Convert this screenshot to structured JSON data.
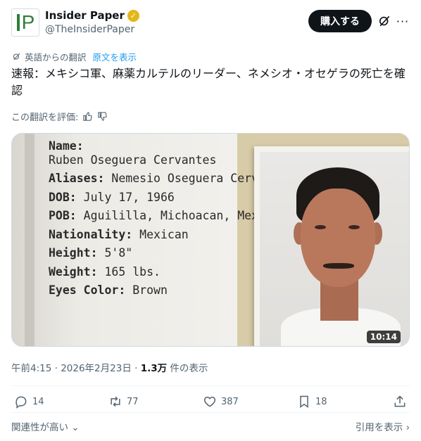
{
  "author": {
    "avatar_text": "P",
    "name": "Insider Paper",
    "handle": "@TheInsiderPaper"
  },
  "header": {
    "subscribe_label": "購入する",
    "more_label": "···"
  },
  "translation": {
    "note": "英語からの翻訳",
    "show_original": "原文を表示",
    "rate_label": "この翻訳を評価:"
  },
  "tweet": {
    "text": "速報：メキシコ軍、麻薬カルテルのリーダー、ネメシオ・オセゲラの死亡を確認"
  },
  "media": {
    "dossier": [
      {
        "label": "Name:",
        "value": "Ruben Oseguera Cervantes",
        "label_bold": true,
        "break": true
      },
      {
        "label": "Aliases:",
        "value": " Nemesio Oseguera Cervantes, \"el Mencho\"",
        "label_bold": true,
        "break": false
      },
      {
        "label": "DOB:",
        "value": " July 17, 1966",
        "label_bold": true,
        "break": false
      },
      {
        "label": "POB:",
        "value": " Aguililla, Michoacan, Mexico",
        "label_bold": true,
        "break": false
      },
      {
        "label": "Nationality:",
        "value": " Mexican",
        "label_bold": true,
        "break": false
      },
      {
        "label": "Height:",
        "value": " 5'8\"",
        "label_bold": true,
        "break": false
      },
      {
        "label": "Weight:",
        "value": " 165 lbs.",
        "label_bold": true,
        "break": false
      },
      {
        "label": "Eyes Color:",
        "value": " Brown",
        "label_bold": true,
        "break": false
      }
    ],
    "duration": "10:14"
  },
  "meta": {
    "time": "午前4:15",
    "date": "2026年2月23日",
    "views_count": "1.3万",
    "views_label": "件の表示",
    "sep": " · "
  },
  "actions": {
    "replies": "14",
    "reposts": "77",
    "likes": "387",
    "bookmarks": "18"
  },
  "footer": {
    "sort_label": "関連性が高い",
    "quotes_label": "引用を表示"
  },
  "colors": {
    "accent": "#1d9bf0",
    "text": "#0f1419",
    "muted": "#536471",
    "verified": "#e2b719",
    "brand_green": "#2f7d3a"
  }
}
